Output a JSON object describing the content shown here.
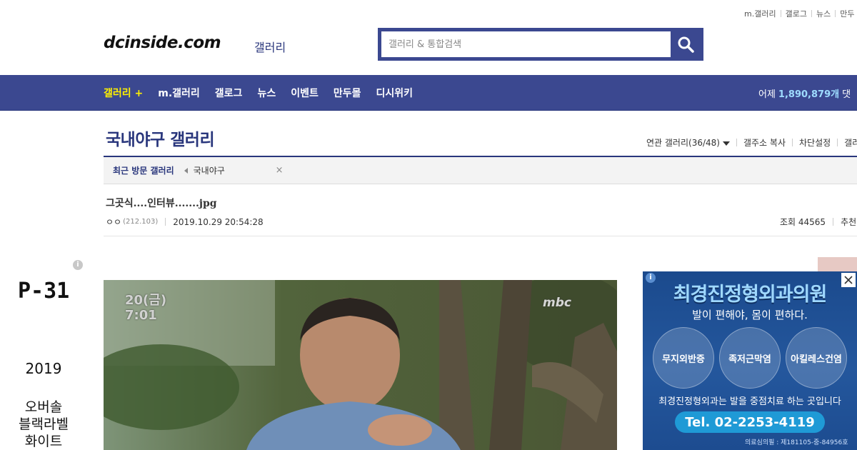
{
  "toplinks": [
    "m.갤러리",
    "갤로그",
    "뉴스",
    "만두"
  ],
  "logo": {
    "text": "dcinside.com",
    "sub": "갤러리"
  },
  "search": {
    "placeholder": "갤러리 & 통합검색",
    "value": ""
  },
  "nav": {
    "items": [
      "갤러리 +",
      "m.갤러리",
      "갤로그",
      "뉴스",
      "이벤트",
      "만두몰",
      "디시위키"
    ],
    "stat_prefix": "어제",
    "stat_value": "1,890,879개",
    "stat_suffix": "댓"
  },
  "gallery": {
    "title": "국내야구 갤러리",
    "related": "연관 갤러리(36/48)",
    "copy": "갤주소 복사",
    "block": "차단설정",
    "extra": "갤러"
  },
  "recent": {
    "label": "최근 방문 갤러리",
    "item": "국내야구",
    "close": "×"
  },
  "post": {
    "title": "그곳식....인터뷰.......jpg",
    "author": "ㅇㅇ",
    "ip": "(212.103)",
    "date": "2019.10.29 20:54:28",
    "views": "조회 44565",
    "recommend": "추천"
  },
  "left_ad": {
    "model": "P-31",
    "year": "2019",
    "desc": [
      "오버솔",
      "블랙라벨",
      "화이트"
    ]
  },
  "main_image": {
    "date_line1": "20(금)",
    "date_line2": "7:01",
    "broadcaster": "mbc"
  },
  "right_ad": {
    "title": "최경진정형외과의원",
    "subtitle": "발이 편해야, 몸이 편하다.",
    "circles": [
      "무지외반증",
      "족저근막염",
      "아킬레스건염"
    ],
    "text": "최경진정형외과는 발을 중점치료 하는 곳입니다",
    "tel": "Tel. 02-2253-4119",
    "footer": "의료심의필 : 제181105-중-84956호"
  },
  "colors": {
    "brand": "#3b4890",
    "brand_dark": "#29367c",
    "highlight": "#fff100"
  }
}
